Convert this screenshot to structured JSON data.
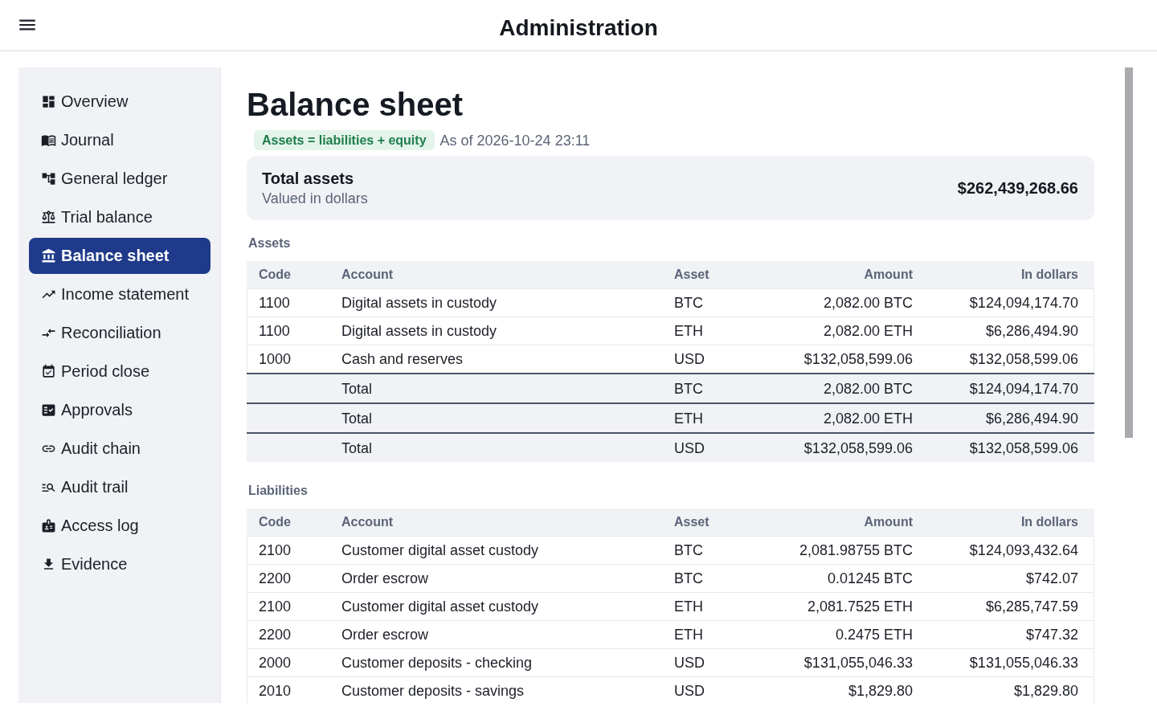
{
  "header": {
    "title": "Administration"
  },
  "sidebar": {
    "items": [
      {
        "label": "Overview",
        "selected": false
      },
      {
        "label": "Journal",
        "selected": false
      },
      {
        "label": "General ledger",
        "selected": false
      },
      {
        "label": "Trial balance",
        "selected": false
      },
      {
        "label": "Balance sheet",
        "selected": true
      },
      {
        "label": "Income statement",
        "selected": false
      },
      {
        "label": "Reconciliation",
        "selected": false
      },
      {
        "label": "Period close",
        "selected": false
      },
      {
        "label": "Approvals",
        "selected": false
      },
      {
        "label": "Audit chain",
        "selected": false
      },
      {
        "label": "Audit trail",
        "selected": false
      },
      {
        "label": "Access log",
        "selected": false
      },
      {
        "label": "Evidence",
        "selected": false
      }
    ]
  },
  "page": {
    "title": "Balance sheet",
    "badge": "Assets = liabilities + equity",
    "as_of": "As of 2026-10-24 23:11",
    "summary": {
      "label": "Total assets",
      "sublabel": "Valued in dollars",
      "value": "$262,439,268.66"
    },
    "sections": [
      {
        "title": "Assets",
        "columns": [
          "Code",
          "Account",
          "Asset",
          "Amount",
          "In dollars"
        ],
        "rows": [
          {
            "kind": "line",
            "code": "1100",
            "account": "Digital assets in custody",
            "asset": "BTC",
            "amount": "2,082.00 BTC",
            "in_dollars": "$124,094,174.70"
          },
          {
            "kind": "line",
            "code": "1100",
            "account": "Digital assets in custody",
            "asset": "ETH",
            "amount": "2,082.00 ETH",
            "in_dollars": "$6,286,494.90"
          },
          {
            "kind": "line",
            "code": "1000",
            "account": "Cash and reserves",
            "asset": "USD",
            "amount": "$132,058,599.06",
            "in_dollars": "$132,058,599.06"
          },
          {
            "kind": "total",
            "account": "Total",
            "asset": "BTC",
            "amount": "2,082.00 BTC",
            "in_dollars": "$124,094,174.70"
          },
          {
            "kind": "total",
            "account": "Total",
            "asset": "ETH",
            "amount": "2,082.00 ETH",
            "in_dollars": "$6,286,494.90"
          },
          {
            "kind": "total",
            "account": "Total",
            "asset": "USD",
            "amount": "$132,058,599.06",
            "in_dollars": "$132,058,599.06"
          }
        ]
      },
      {
        "title": "Liabilities",
        "columns": [
          "Code",
          "Account",
          "Asset",
          "Amount",
          "In dollars"
        ],
        "rows": [
          {
            "kind": "line",
            "code": "2100",
            "account": "Customer digital asset custody",
            "asset": "BTC",
            "amount": "2,081.98755 BTC",
            "in_dollars": "$124,093,432.64"
          },
          {
            "kind": "line",
            "code": "2200",
            "account": "Order escrow",
            "asset": "BTC",
            "amount": "0.01245 BTC",
            "in_dollars": "$742.07"
          },
          {
            "kind": "line",
            "code": "2100",
            "account": "Customer digital asset custody",
            "asset": "ETH",
            "amount": "2,081.7525 ETH",
            "in_dollars": "$6,285,747.59"
          },
          {
            "kind": "line",
            "code": "2200",
            "account": "Order escrow",
            "asset": "ETH",
            "amount": "0.2475 ETH",
            "in_dollars": "$747.32"
          },
          {
            "kind": "line",
            "code": "2000",
            "account": "Customer deposits - checking",
            "asset": "USD",
            "amount": "$131,055,046.33",
            "in_dollars": "$131,055,046.33"
          },
          {
            "kind": "line",
            "code": "2010",
            "account": "Customer deposits - savings",
            "asset": "USD",
            "amount": "$1,829.80",
            "in_dollars": "$1,829.80"
          }
        ]
      }
    ]
  }
}
